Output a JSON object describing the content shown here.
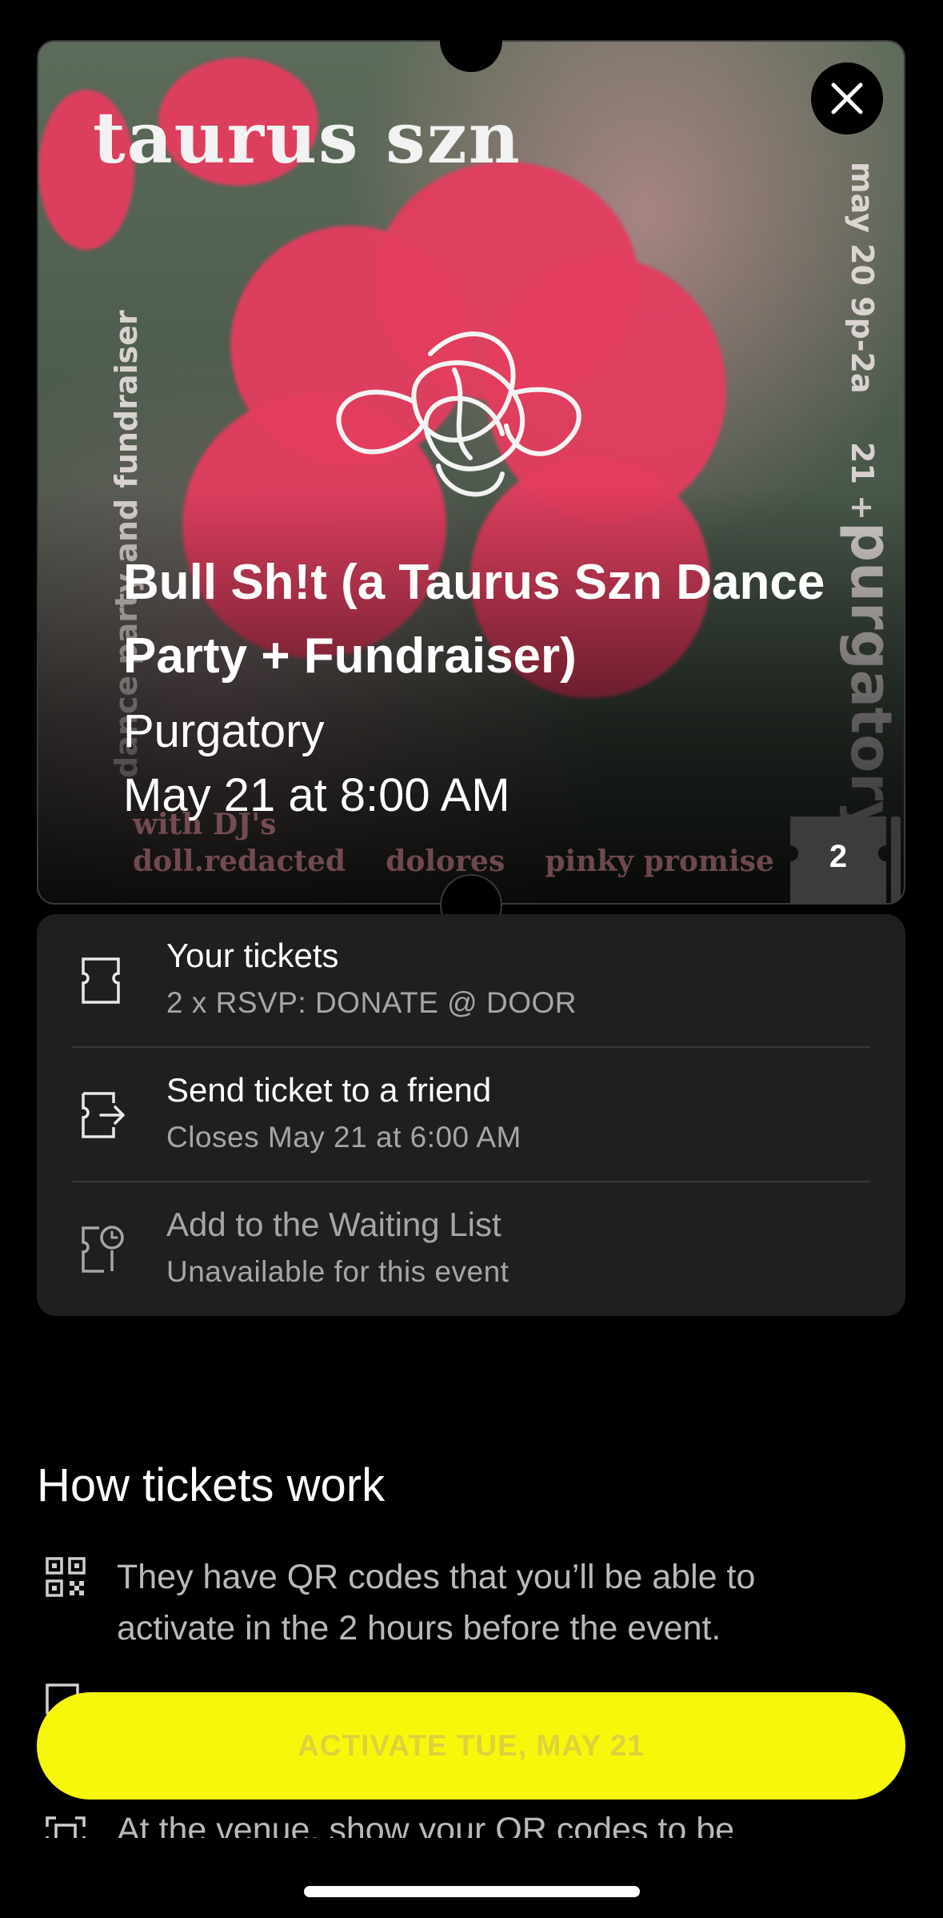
{
  "poster": {
    "wordmark": "taurus szn",
    "left_vertical": "dance party and fundraiser",
    "right_vertical_top": "may 20 9p-2a",
    "right_vertical_age": "21 +",
    "right_vertical_venue": "purgatory",
    "djs_line1": "with DJ's",
    "djs_line2": "doll.redacted    dolores    pinky promise"
  },
  "event": {
    "title": "Bull Sh!t (a Taurus Szn Dance Party + Fundraiser)",
    "venue": "Purgatory",
    "date": "May 21 at 8:00 AM",
    "ticket_count": "2"
  },
  "tickets_card": {
    "rows": [
      {
        "title": "Your tickets",
        "subtitle": "2 x RSVP: DONATE @ DOOR",
        "icon": "ticket-icon"
      },
      {
        "title": "Send ticket to a friend",
        "subtitle": "Closes May 21 at 6:00 AM",
        "icon": "send-ticket-icon"
      },
      {
        "title": "Add to the Waiting List",
        "subtitle": "Unavailable for this event",
        "icon": "waitlist-clock-icon"
      }
    ]
  },
  "how_tickets_work": {
    "title": "How tickets work",
    "items": [
      {
        "text": "They have QR codes that you’ll be able to activate in the 2 hours before the event.",
        "icon": "qr-code-icon"
      },
      {
        "text": "At the venue, show your QR codes to be",
        "icon": "scan-icon"
      }
    ]
  },
  "activate_button": {
    "label": "ACTIVATE TUE, MAY 21"
  },
  "colors": {
    "accent": "#f7f70c",
    "card": "#1f1f1f",
    "petal": "#e43d5f"
  }
}
